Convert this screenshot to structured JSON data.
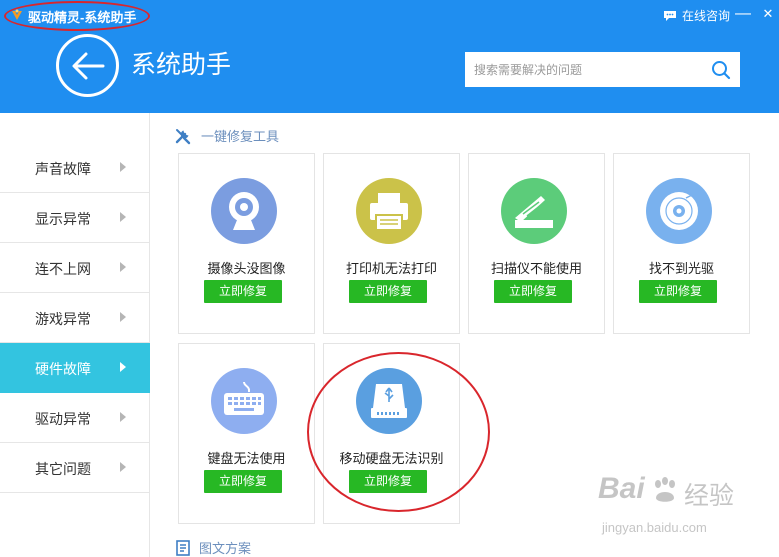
{
  "window": {
    "title": "驱动精灵-系统助手",
    "consult_label": "在线咨询",
    "minimize_glyph": "—",
    "close_glyph": "✕"
  },
  "header": {
    "page_title": "系统助手",
    "search_placeholder": "搜索需要解决的问题"
  },
  "sidebar": {
    "items": [
      {
        "label": "声音故障",
        "active": false
      },
      {
        "label": "显示异常",
        "active": false
      },
      {
        "label": "连不上网",
        "active": false
      },
      {
        "label": "游戏异常",
        "active": false
      },
      {
        "label": "硬件故障",
        "active": true
      },
      {
        "label": "驱动异常",
        "active": false
      },
      {
        "label": "其它问题",
        "active": false
      }
    ]
  },
  "main": {
    "section_title": "一键修复工具",
    "fix_label": "立即修复",
    "cards": [
      {
        "name": "摄像头没图像",
        "icon": "webcam-icon",
        "color": "#7b9de0"
      },
      {
        "name": "打印机无法打印",
        "icon": "printer-icon",
        "color": "#cbc249"
      },
      {
        "name": "扫描仪不能使用",
        "icon": "scanner-icon",
        "color": "#5ccc7a"
      },
      {
        "name": "找不到光驱",
        "icon": "disc-icon",
        "color": "#79b1ee"
      },
      {
        "name": "键盘无法使用",
        "icon": "keyboard-icon",
        "color": "#8eaef0"
      },
      {
        "name": "移动硬盘无法识别",
        "icon": "usb-drive-icon",
        "color": "#5a9fe0"
      }
    ],
    "second_section_title": "图文方案"
  },
  "watermark": {
    "brand": "Bai",
    "brand2": "经验",
    "url": "jingyan.baidu.com"
  },
  "colors": {
    "header": "#1f8ef0",
    "active": "#33c4e0",
    "fix_button": "#27b824",
    "annotation": "#d9262c"
  }
}
